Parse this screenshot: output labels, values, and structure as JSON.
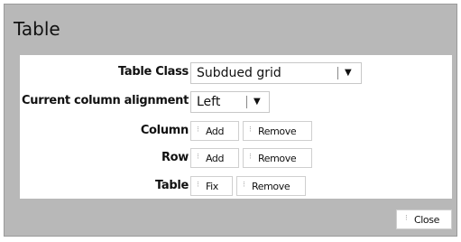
{
  "dialog": {
    "title": "Table"
  },
  "fields": {
    "table_class": {
      "label": "Table Class",
      "value": "Subdued grid",
      "arrow": "▼"
    },
    "alignment": {
      "label": "Current column alignment",
      "value": "Left",
      "arrow": "▼"
    },
    "column": {
      "label": "Column",
      "add": "Add",
      "remove": "Remove"
    },
    "row": {
      "label": "Row",
      "add": "Add",
      "remove": "Remove"
    },
    "table": {
      "label": "Table",
      "fix": "Fix",
      "remove": "Remove"
    }
  },
  "footer": {
    "close": "Close"
  },
  "icons": {
    "button_icon": "⁝"
  }
}
